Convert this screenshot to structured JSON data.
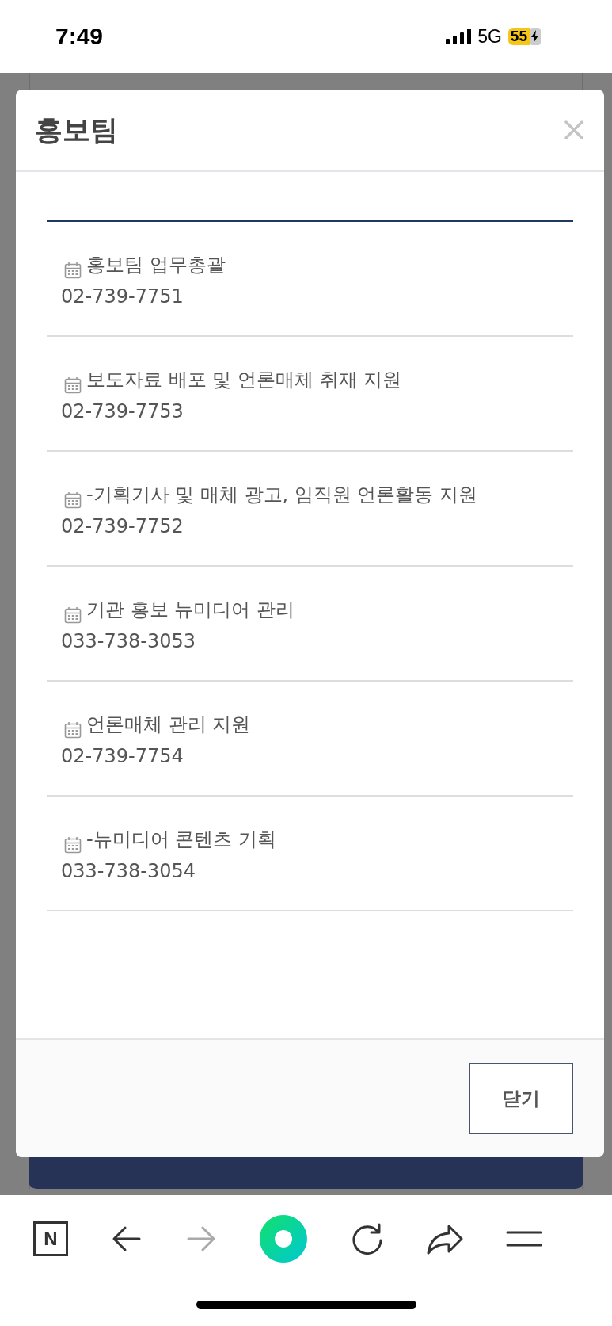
{
  "status_bar": {
    "time": "7:49",
    "network": "5G",
    "battery": "55"
  },
  "modal": {
    "title": "홍보팀",
    "items": [
      {
        "task": "홍보팀 업무총괄",
        "phone": "02-739-7751"
      },
      {
        "task": "보도자료 배포 및 언론매체 취재 지원",
        "phone": "02-739-7753"
      },
      {
        "task": "-기획기사 및 매체 광고, 임직원 언론활동 지원",
        "phone": "02-739-7752"
      },
      {
        "task": "기관 홍보 뉴미디어 관리",
        "phone": "033-738-3053"
      },
      {
        "task": "언론매체 관리 지원",
        "phone": "02-739-7754"
      },
      {
        "task": "-뉴미디어 콘텐츠 기획",
        "phone": "033-738-3054"
      }
    ],
    "close_button": "닫기"
  },
  "browser_toolbar": {
    "home_letter": "N"
  }
}
